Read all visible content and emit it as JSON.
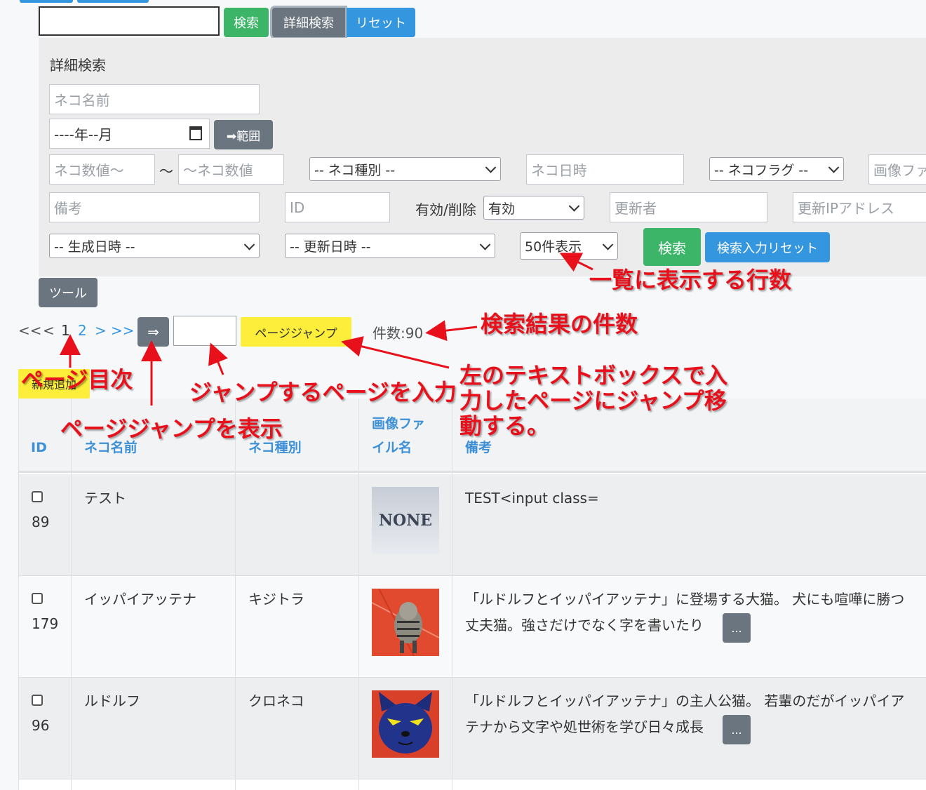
{
  "top": {
    "search_button": "検索",
    "advanced_button": "詳細検索",
    "reset_button": "リセット"
  },
  "advanced": {
    "title": "詳細検索",
    "name_placeholder": "ネコ名前",
    "month_value": "----年--月",
    "range_button": "➡範囲",
    "num_from_placeholder": "ネコ数値〜",
    "tilde": "〜",
    "num_to_placeholder": "〜ネコ数値",
    "kind_select": "-- ネコ種別 --",
    "datetime_placeholder": "ネコ日時",
    "flag_select": "-- ネコフラグ --",
    "image_placeholder": "画像ファ",
    "note_placeholder": "備考",
    "id_placeholder": "ID",
    "valid_label": "有効/削除",
    "valid_select": "有効",
    "updater_placeholder": "更新者",
    "ip_placeholder": "更新IPアドレス",
    "created_select": "-- 生成日時 --",
    "updated_select": "-- 更新日時 --",
    "per_page_select": "50件表示",
    "search_button": "検索",
    "reset_button": "検索入力リセット"
  },
  "tool_button": "ツール",
  "pager": {
    "first": "<<",
    "prev": "<",
    "current": "1",
    "page2": "2",
    "next": ">",
    "last": ">>",
    "jump_toggle": "⇒",
    "jump_button": "ページジャンプ",
    "count_label": "件数:90"
  },
  "new_button": "新規追加",
  "table": {
    "headers": {
      "id": "ID",
      "name": "ネコ名前",
      "kind": "ネコ種別",
      "image_1": "画像ファ",
      "image_2": "イル名",
      "note": "備考"
    },
    "rows": [
      {
        "id": "89",
        "name": "テスト",
        "kind": "",
        "image": "NONE",
        "note_1": "TEST<input class=",
        "note_2": ""
      },
      {
        "id": "179",
        "name": "イッパイアッテナ",
        "kind": "キジトラ",
        "image": "",
        "note_1": "「ルドルフとイッパイアッテナ」に登場する大猫。 犬にも喧嘩に勝つ",
        "note_2": "丈夫猫。強さだけでなく字を書いたり"
      },
      {
        "id": "96",
        "name": "ルドルフ",
        "kind": "クロネコ",
        "image": "",
        "note_1": "「ルドルフとイッパイアッテナ」の主人公猫。 若輩のだがイッパイア",
        "note_2": "テナから文字や処世術を学び日々成長"
      }
    ],
    "more_button": "..."
  },
  "annotations": {
    "rows_per_page": "一覧に表示する行数",
    "result_count": "検索結果の件数",
    "page_index": "ページ目次",
    "jump_input": "ジャンプするページを入力",
    "jump_desc_1": "左のテキストボックスで入",
    "jump_desc_2": "力したページにジャンプ移",
    "jump_desc_3": "動する。",
    "show_jump": "ページジャンプを表示"
  },
  "colors": {
    "green": "#3cb569",
    "blue": "#3596e0",
    "gray": "#6b7580",
    "yellow": "#fcee3a",
    "annotation": "#e8101a",
    "header_link": "#3d8fd6"
  }
}
